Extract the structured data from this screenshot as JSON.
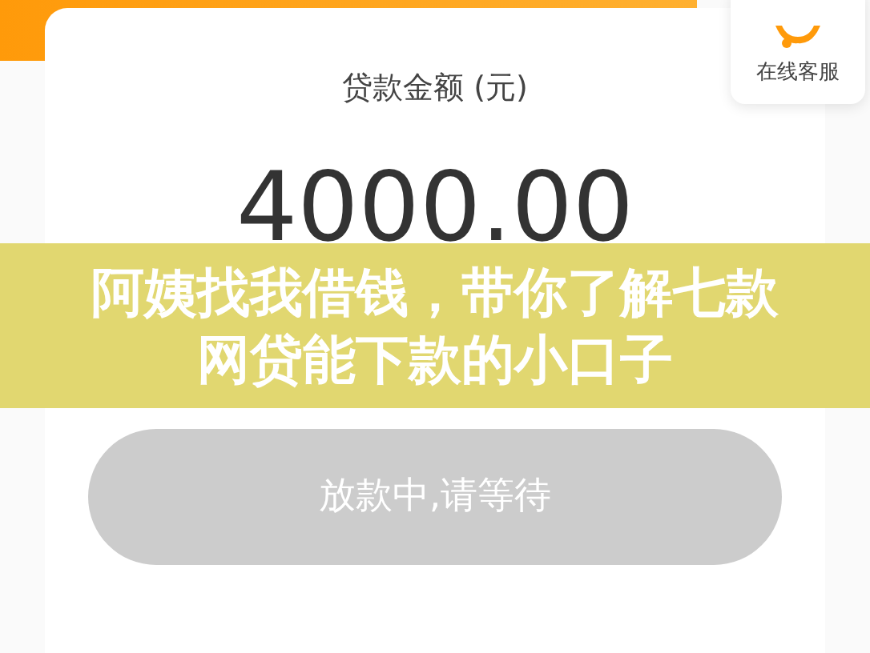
{
  "service": {
    "label": "在线客服"
  },
  "loan": {
    "label": "贷款金额 (元)",
    "amount": "4000.00"
  },
  "button": {
    "label": "放款中,请等待",
    "disabled": true
  },
  "overlay": {
    "title": "阿姨找我借钱，带你了解七款网贷能下款的小口子"
  }
}
